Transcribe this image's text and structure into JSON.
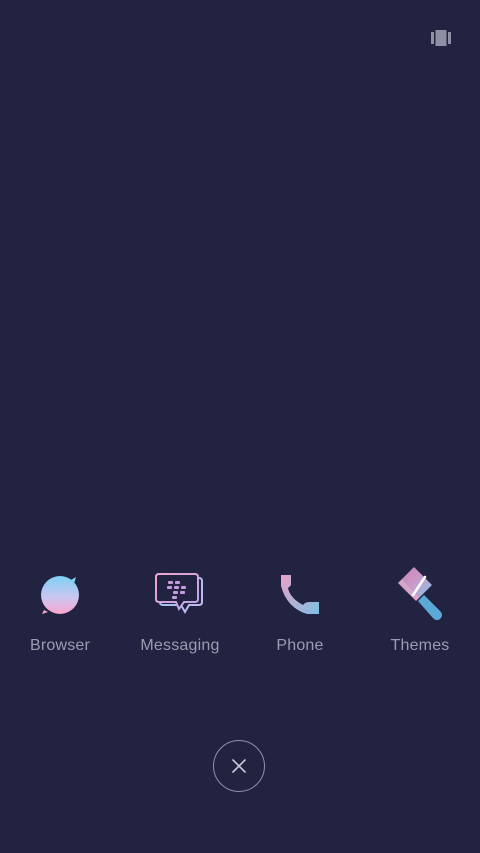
{
  "top_bar": {
    "icon": "multitask-icon"
  },
  "apps": [
    {
      "label": "Browser",
      "icon": "browser-icon"
    },
    {
      "label": "Messaging",
      "icon": "messaging-icon"
    },
    {
      "label": "Phone",
      "icon": "phone-icon"
    },
    {
      "label": "Themes",
      "icon": "themes-icon"
    }
  ],
  "close_button": {
    "icon": "close-icon"
  },
  "colors": {
    "background": "#212341",
    "label": "#9a9cb0",
    "accent_pink": "#f4a6c8",
    "accent_blue": "#7ec6e8"
  }
}
